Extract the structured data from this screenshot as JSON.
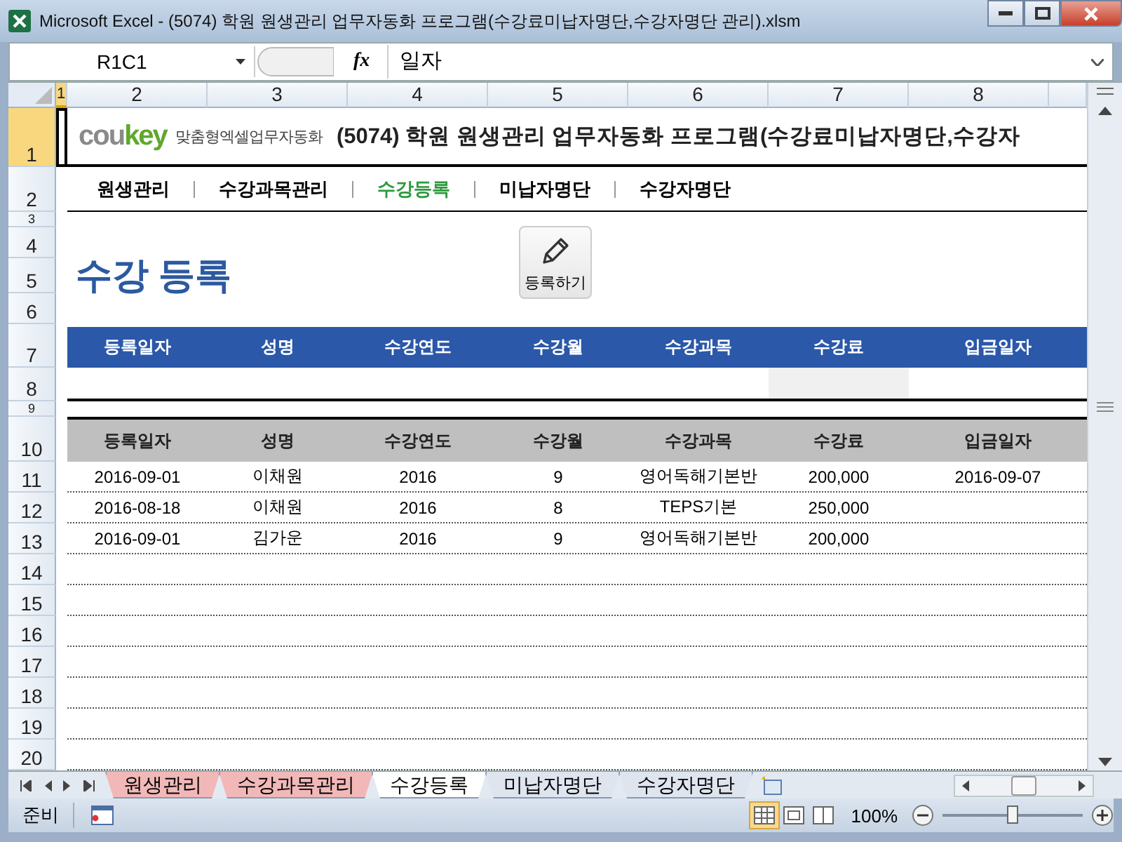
{
  "window": {
    "title": "Microsoft Excel - (5074) 학원 원생관리 업무자동화 프로그램(수강료미납자명단,수강자명단 관리).xlsm"
  },
  "formula_bar": {
    "name_box": "R1C1",
    "function_label": "fx",
    "value": "일자"
  },
  "column_headers": [
    {
      "label": "1",
      "selected": true
    },
    {
      "label": "2",
      "selected": false
    },
    {
      "label": "3",
      "selected": false
    },
    {
      "label": "4",
      "selected": false
    },
    {
      "label": "5",
      "selected": false
    },
    {
      "label": "6",
      "selected": false
    },
    {
      "label": "7",
      "selected": false
    },
    {
      "label": "8",
      "selected": false
    }
  ],
  "row_headers": [
    {
      "label": "1",
      "selected": true
    },
    {
      "label": "2",
      "selected": false
    },
    {
      "label": "3",
      "selected": false
    },
    {
      "label": "4",
      "selected": false
    },
    {
      "label": "5",
      "selected": false
    },
    {
      "label": "6",
      "selected": false
    },
    {
      "label": "7",
      "selected": false
    },
    {
      "label": "8",
      "selected": false
    },
    {
      "label": "9",
      "selected": false
    },
    {
      "label": "10",
      "selected": false
    },
    {
      "label": "11",
      "selected": false
    },
    {
      "label": "12",
      "selected": false
    },
    {
      "label": "13",
      "selected": false
    },
    {
      "label": "14",
      "selected": false
    },
    {
      "label": "15",
      "selected": false
    },
    {
      "label": "16",
      "selected": false
    },
    {
      "label": "17",
      "selected": false
    },
    {
      "label": "18",
      "selected": false
    },
    {
      "label": "19",
      "selected": false
    },
    {
      "label": "20",
      "selected": false
    }
  ],
  "sheet": {
    "logo": {
      "parts": [
        "cou",
        "key"
      ],
      "tagline": "맞춤형엑셀업무자동화"
    },
    "title": "(5074) 학원 원생관리 업무자동화 프로그램(수강료미납자명단,수강자",
    "nav": [
      {
        "label": "원생관리",
        "selected": false
      },
      {
        "label": "수강과목관리",
        "selected": false
      },
      {
        "label": "수강등록",
        "selected": true
      },
      {
        "label": "미납자명단",
        "selected": false
      },
      {
        "label": "수강자명단",
        "selected": false
      }
    ],
    "heading": "수강 등록",
    "register_button": "등록하기",
    "input_table": {
      "columns": [
        "등록일자",
        "성명",
        "수강연도",
        "수강월",
        "수강과목",
        "수강료",
        "입금일자"
      ]
    },
    "list_table": {
      "columns": [
        "등록일자",
        "성명",
        "수강연도",
        "수강월",
        "수강과목",
        "수강료",
        "입금일자"
      ],
      "rows": [
        [
          "2016-09-01",
          "이채원",
          "2016",
          "9",
          "영어독해기본반",
          "200,000",
          "2016-09-07"
        ],
        [
          "2016-08-18",
          "이채원",
          "2016",
          "8",
          "TEPS기본",
          "250,000",
          ""
        ],
        [
          "2016-09-01",
          "김가운",
          "2016",
          "9",
          "영어독해기본반",
          "200,000",
          ""
        ]
      ]
    }
  },
  "sheet_tabs": [
    {
      "label": "원생관리",
      "selected": false,
      "color": "#f2b8b8"
    },
    {
      "label": "수강과목관리",
      "selected": false,
      "color": "#f2b8b8"
    },
    {
      "label": "수강등록",
      "selected": true
    },
    {
      "label": "미납자명단",
      "selected": false
    },
    {
      "label": "수강자명단",
      "selected": false
    }
  ],
  "status_bar": {
    "status": "준비",
    "zoom": "100%",
    "zoom_slider": {
      "level": 0.5
    }
  }
}
